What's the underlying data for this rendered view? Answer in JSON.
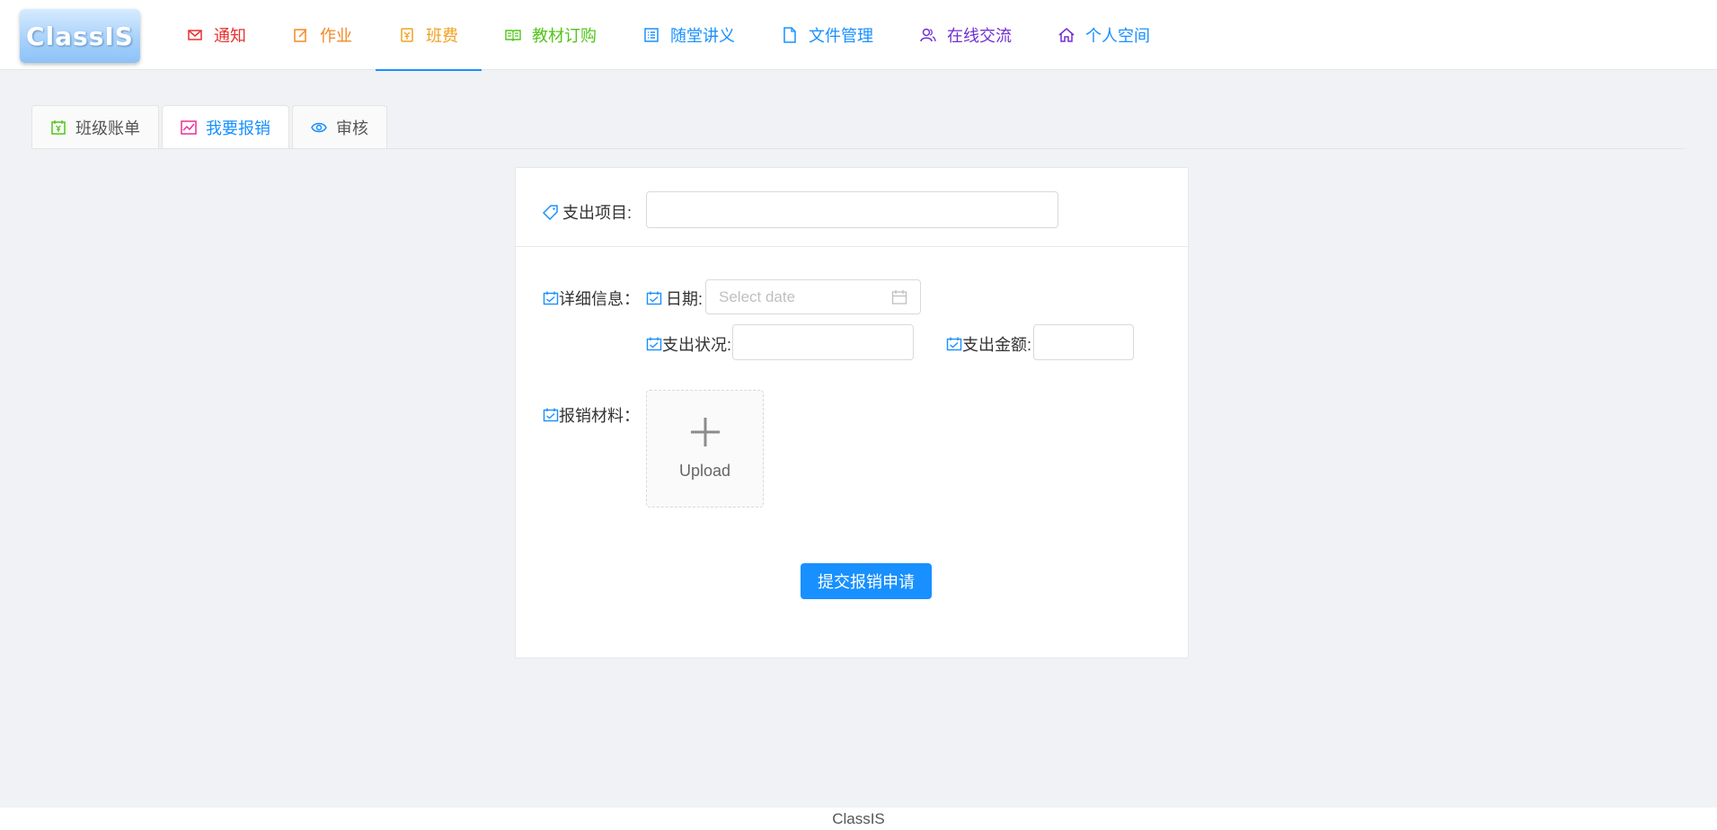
{
  "app": {
    "logo_text": "ClassIS",
    "footer_text": "ClassIS"
  },
  "nav": {
    "items": [
      {
        "label": "通知",
        "icon": "mail-icon",
        "color": "#e8312f"
      },
      {
        "label": "作业",
        "icon": "edit-icon",
        "color": "#f08a24"
      },
      {
        "label": "班费",
        "icon": "yen-icon",
        "color": "#f0a020",
        "active": true
      },
      {
        "label": "教材订购",
        "icon": "book-icon",
        "color": "#52c41a"
      },
      {
        "label": "随堂讲义",
        "icon": "list-icon",
        "color": "#1890ff"
      },
      {
        "label": "文件管理",
        "icon": "file-icon",
        "color": "#1890ff"
      },
      {
        "label": "在线交流",
        "icon": "users-icon",
        "color": "#722ed1"
      },
      {
        "label": "个人空间",
        "icon": "home-icon",
        "color": "#1890ff"
      }
    ]
  },
  "tabs": [
    {
      "label": "班级账单",
      "icon": "bill-icon",
      "icon_color": "#52c41a"
    },
    {
      "label": "我要报销",
      "icon": "chart-icon",
      "icon_color": "#eb2f96",
      "active": true
    },
    {
      "label": "审核",
      "icon": "eye-icon",
      "icon_color": "#1890ff"
    }
  ],
  "form": {
    "expense_item_label": "支出项目:",
    "expense_item_value": "",
    "details_label": "详细信息：",
    "date_label": "日期:",
    "date_placeholder": "Select date",
    "status_label": "支出状况:",
    "status_value": "",
    "amount_label": "支出金额:",
    "amount_value": "",
    "materials_label": "报销材料：",
    "upload_label": "Upload",
    "submit_label": "提交报销申请"
  },
  "colors": {
    "accent": "#1890ff",
    "background": "#f0f2f5"
  }
}
